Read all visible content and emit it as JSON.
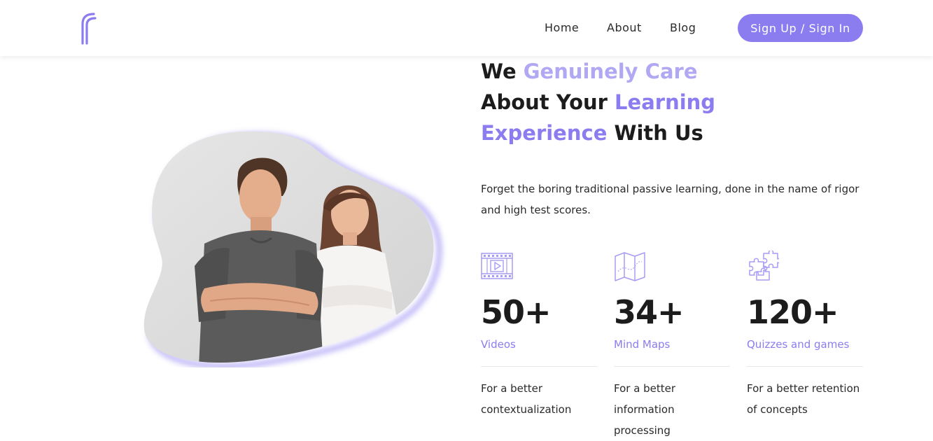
{
  "theme": {
    "accent": "#8b7cf0",
    "accent_light": "#b1a8f3",
    "text_dark": "#1c1c1c"
  },
  "header": {
    "logo_icon": "brand-logo-icon",
    "nav": {
      "home": "Home",
      "about": "About",
      "blog": "Blog"
    },
    "auth_button": "Sign Up / Sign In"
  },
  "hero": {
    "image_icon": "students-photo",
    "headline": {
      "line1_a": "We ",
      "line1_b": "Genuinely Care",
      "line2_a": "About Your ",
      "line2_b": "Learning",
      "line3_a": "Experience",
      "line3_b": " With Us"
    },
    "intro": "Forget the boring traditional passive learning, done in the name of rigor and high test scores."
  },
  "stats": [
    {
      "icon": "video-film-icon",
      "value": "50+",
      "label": "Videos",
      "desc": "For a better contextualization"
    },
    {
      "icon": "folded-map-icon",
      "value": "34+",
      "label": "Mind Maps",
      "desc": "For a better information processing"
    },
    {
      "icon": "puzzle-pieces-icon",
      "value": "120+",
      "label": "Quizzes and games",
      "desc": "For a better retention of concepts"
    }
  ]
}
